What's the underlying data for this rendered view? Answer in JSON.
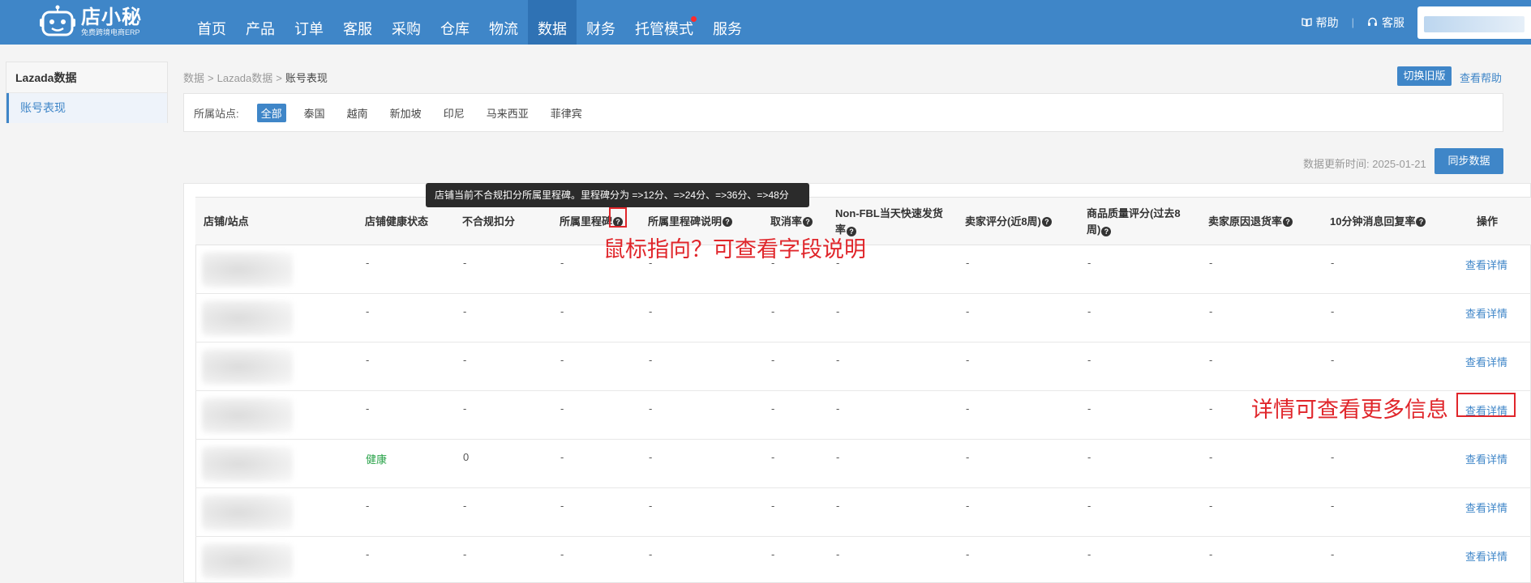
{
  "logo": {
    "title": "店小秘",
    "subtitle": "免费跨境电商ERP"
  },
  "nav": [
    "首页",
    "产品",
    "订单",
    "客服",
    "采购",
    "仓库",
    "物流",
    "数据",
    "财务",
    "托管模式",
    "服务"
  ],
  "nav_active_index": 7,
  "nav_notify_index": 9,
  "top_right": {
    "help": "帮助",
    "service": "客服"
  },
  "sidebar": {
    "title": "Lazada数据",
    "item": "账号表现"
  },
  "breadcrumb": {
    "root": "数据",
    "sep": ">",
    "middle": "Lazada数据",
    "current": "账号表现"
  },
  "switch_old": "切换旧版",
  "view_help": "查看帮助",
  "filter": {
    "label": "所属站点:",
    "options": [
      "全部",
      "泰国",
      "越南",
      "新加坡",
      "印尼",
      "马来西亚",
      "菲律宾"
    ],
    "active_index": 0
  },
  "update_time": "数据更新时间: 2025-01-21",
  "sync_button": "同步数据",
  "table": {
    "headers": {
      "shop": "店铺/站点",
      "health": "店铺健康状态",
      "penalty": "不合规扣分",
      "milestone": "所属里程碑",
      "milestone_desc": "所属里程碑说明",
      "cancel": "取消率",
      "nonfbl": "Non-FBL当天快速发货率",
      "seller_rating": "卖家评分(近8周)",
      "quality": "商品质量评分(过去8周)",
      "return": "卖家原因退货率",
      "reply": "10分钟消息回复率",
      "action": "操作"
    },
    "rows": [
      {
        "health": "-",
        "penalty": "-",
        "milestone": "-",
        "desc": "-",
        "cancel": "-",
        "nonfbl": "-",
        "rating": "-",
        "quality": "-",
        "return": "-",
        "reply": "-",
        "action": "查看详情"
      },
      {
        "health": "-",
        "penalty": "-",
        "milestone": "-",
        "desc": "-",
        "cancel": "-",
        "nonfbl": "-",
        "rating": "-",
        "quality": "-",
        "return": "-",
        "reply": "-",
        "action": "查看详情"
      },
      {
        "health": "-",
        "penalty": "-",
        "milestone": "-",
        "desc": "-",
        "cancel": "-",
        "nonfbl": "-",
        "rating": "-",
        "quality": "-",
        "return": "-",
        "reply": "-",
        "action": "查看详情"
      },
      {
        "health": "-",
        "penalty": "-",
        "milestone": "-",
        "desc": "-",
        "cancel": "-",
        "nonfbl": "-",
        "rating": "-",
        "quality": "-",
        "return": "-",
        "reply": "-",
        "action": "查看详情"
      },
      {
        "health": "健康",
        "penalty": "0",
        "milestone": "-",
        "desc": "-",
        "cancel": "-",
        "nonfbl": "-",
        "rating": "-",
        "quality": "-",
        "return": "-",
        "reply": "-",
        "action": "查看详情"
      },
      {
        "health": "-",
        "penalty": "-",
        "milestone": "-",
        "desc": "-",
        "cancel": "-",
        "nonfbl": "-",
        "rating": "-",
        "quality": "-",
        "return": "-",
        "reply": "-",
        "action": "查看详情"
      },
      {
        "health": "-",
        "penalty": "-",
        "milestone": "-",
        "desc": "-",
        "cancel": "-",
        "nonfbl": "-",
        "rating": "-",
        "quality": "-",
        "return": "-",
        "reply": "-",
        "action": "查看详情"
      }
    ]
  },
  "tooltip": "店铺当前不合规扣分所属里程碑。里程碑分为 =>12分、=>24分、=>36分、=>48分",
  "annotations": {
    "hover_tip": "鼠标指向？可查看字段说明",
    "detail_tip": "详情可查看更多信息"
  },
  "colors": {
    "brand": "#3f86c8",
    "nav_active": "#2f72b4",
    "healthy": "#2aa34a",
    "annotation": "#e0262b"
  }
}
